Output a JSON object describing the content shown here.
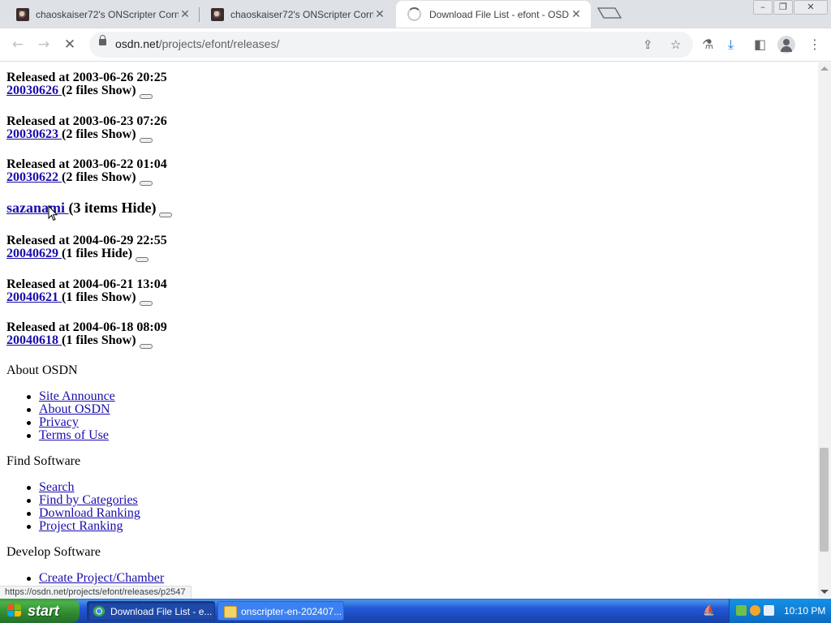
{
  "browser": {
    "tabs": [
      {
        "title": "chaoskaiser72's ONScripter Corner",
        "active": false
      },
      {
        "title": "chaoskaiser72's ONScripter Corner",
        "active": false
      },
      {
        "title": "Download File List - efont - OSDN",
        "active": true,
        "loading": true
      }
    ],
    "address": {
      "host": "osdn.net",
      "path": "/projects/efont/releases/"
    },
    "status_url": "https://osdn.net/projects/efont/releases/p2547"
  },
  "page": {
    "releases_top": [
      {
        "released": "Released at 2003-06-26 20:25",
        "link": "20030626 ",
        "files": "(2 files Show)"
      },
      {
        "released": "Released at 2003-06-23 07:26",
        "link": "20030623 ",
        "files": "(2 files Show)"
      },
      {
        "released": "Released at 2003-06-22 01:04",
        "link": "20030622 ",
        "files": "(2 files Show)"
      }
    ],
    "package": {
      "name": "sazanami ",
      "items": "(3 items Hide)"
    },
    "releases_bottom": [
      {
        "released": "Released at 2004-06-29 22:55",
        "link": "20040629 ",
        "files": "(1 files Hide)"
      },
      {
        "released": "Released at 2004-06-21 13:04",
        "link": "20040621 ",
        "files": "(1 files Show)"
      },
      {
        "released": "Released at 2004-06-18 08:09",
        "link": "20040618 ",
        "files": "(1 files Show)"
      }
    ],
    "footer": {
      "about": {
        "heading": "About OSDN",
        "links": [
          "Site Announce",
          "About OSDN",
          "Privacy",
          "Terms of Use"
        ]
      },
      "find": {
        "heading": "Find Software",
        "links": [
          "Search",
          "Find by Categories",
          "Download Ranking",
          "Project Ranking"
        ]
      },
      "develop": {
        "heading": "Develop Software",
        "links": [
          "Create Project/Chamber"
        ]
      }
    }
  },
  "taskbar": {
    "start_label": "start",
    "tasks": [
      {
        "label": "Download File List - e...",
        "active": true
      },
      {
        "label": "onscripter-en-202407...",
        "active": false
      }
    ],
    "clock": "10:10 PM"
  }
}
